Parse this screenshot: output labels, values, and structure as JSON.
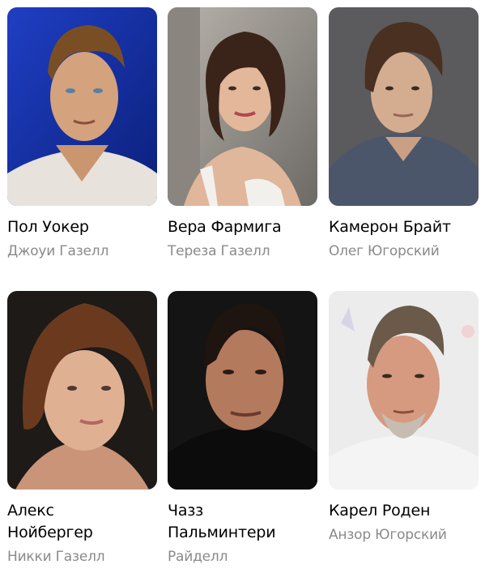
{
  "cast": [
    {
      "actor": "Пол Уокер",
      "role": "Джоуи Газелл",
      "photo_icon": "actor-photo"
    },
    {
      "actor": "Вера Фармига",
      "role": "Тереза Газелл",
      "photo_icon": "actor-photo"
    },
    {
      "actor": "Камерон Брайт",
      "role": "Олег Югорский",
      "photo_icon": "actor-photo"
    },
    {
      "actor_line1": "Алекс",
      "actor_line2": "Нойбергер",
      "role": "Никки Газелл",
      "photo_icon": "actor-photo"
    },
    {
      "actor_line1": "Чазз",
      "actor_line2": "Пальминтери",
      "role": "Райделл",
      "photo_icon": "actor-photo"
    },
    {
      "actor": "Карел Роден",
      "role": "Анзор Югорский",
      "photo_icon": "actor-photo"
    }
  ],
  "colors": {
    "name_text": "#000000",
    "role_text": "#8a8a8a",
    "background": "#ffffff"
  }
}
